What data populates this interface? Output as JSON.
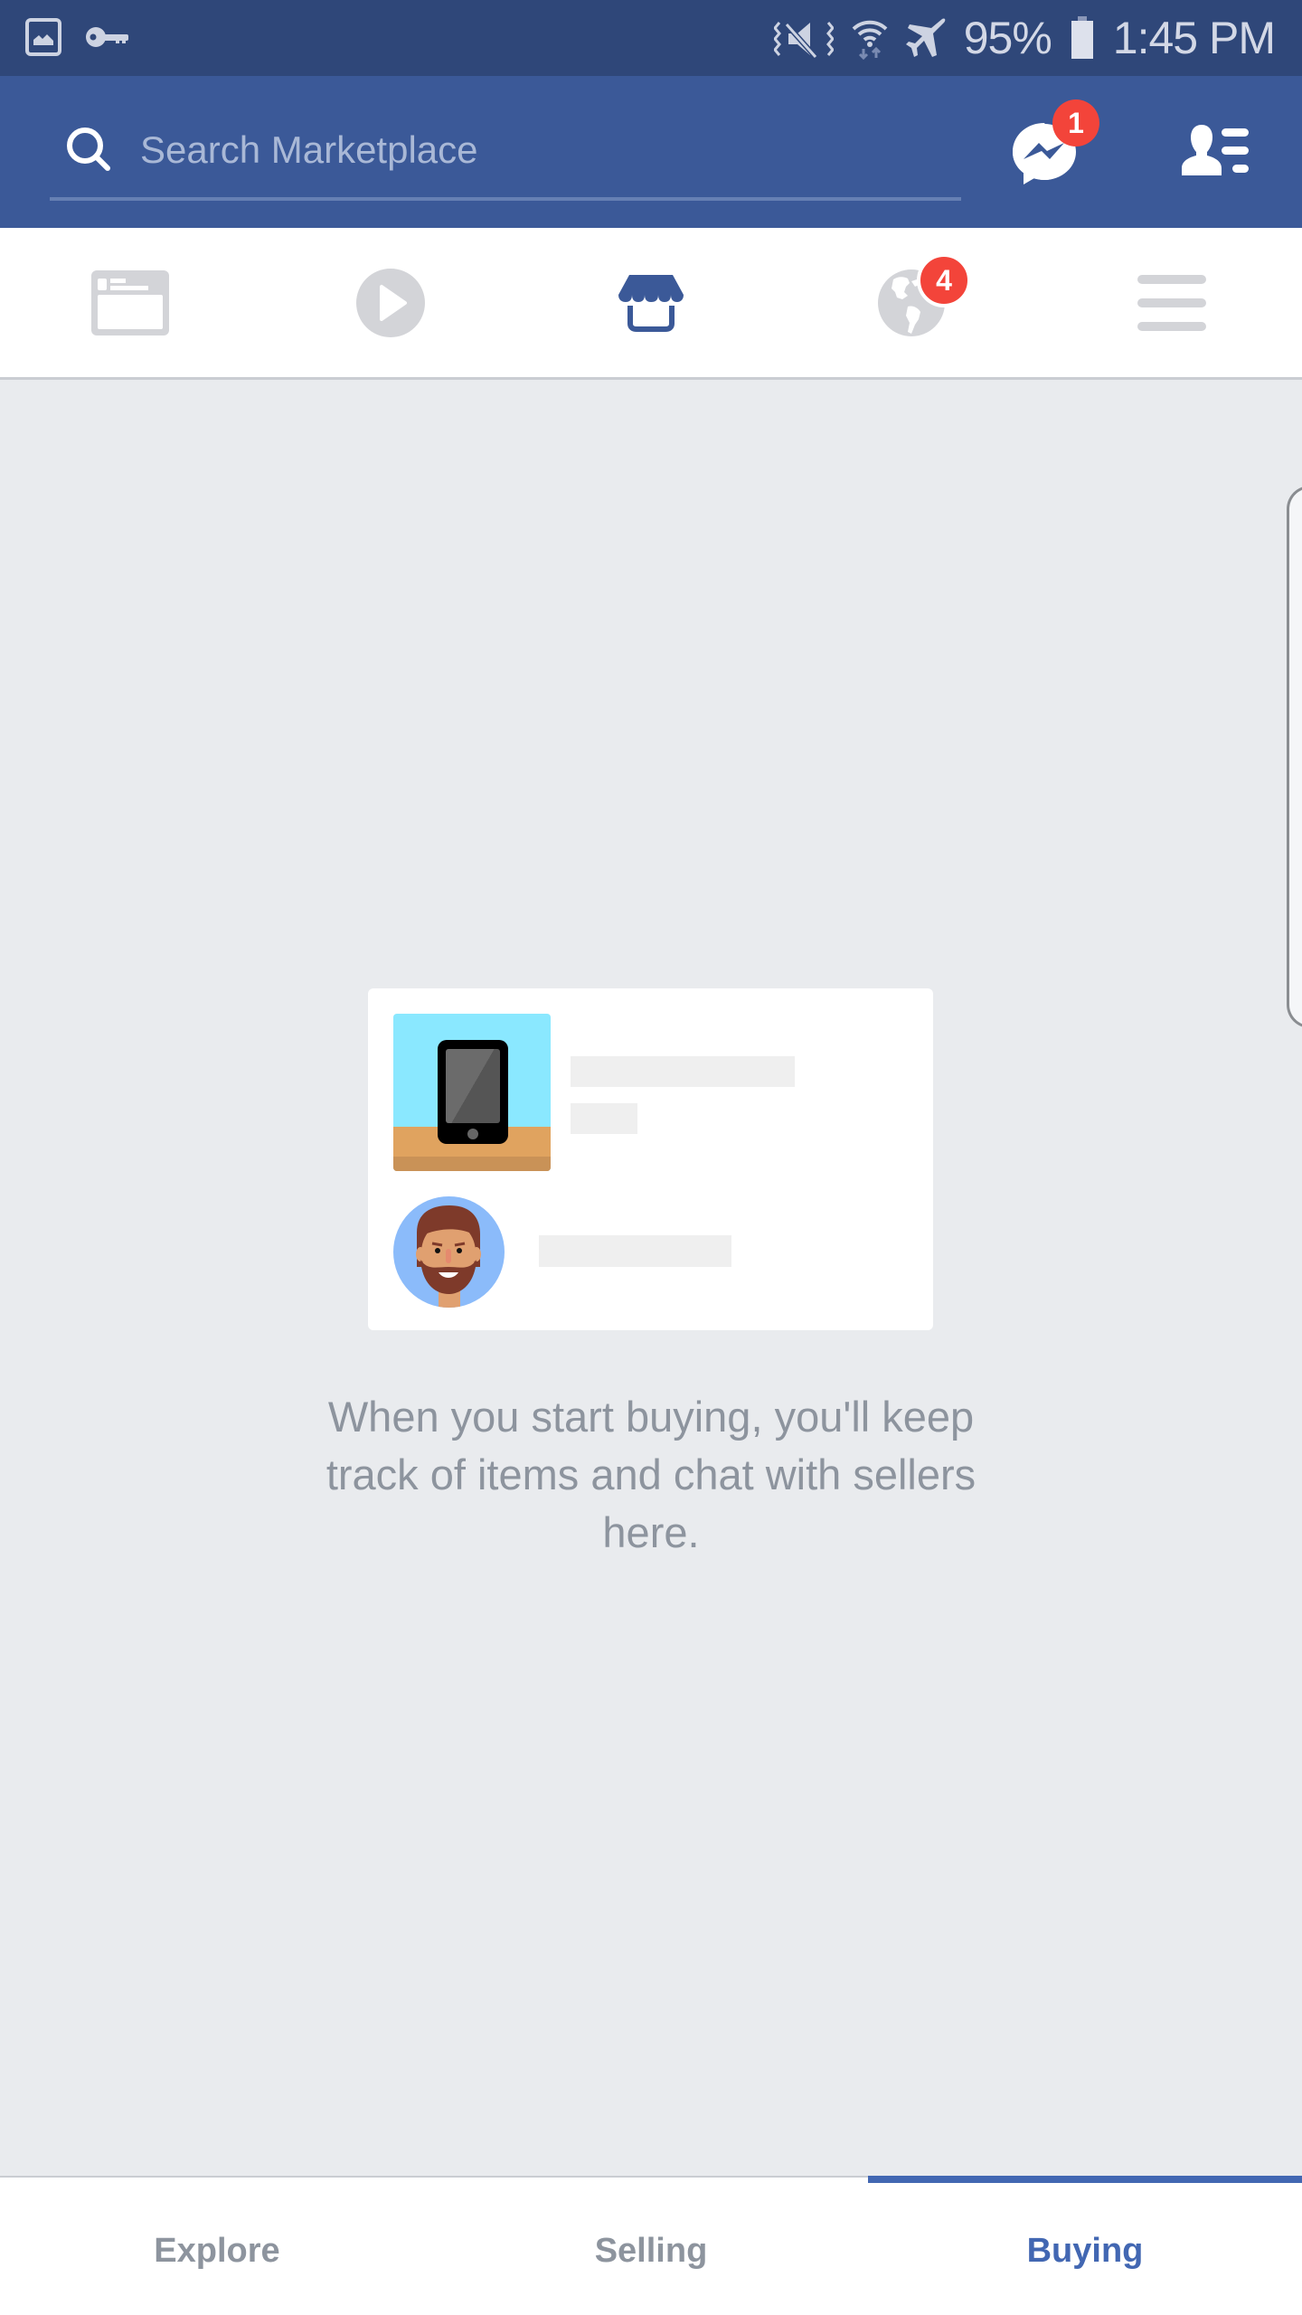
{
  "status_bar": {
    "left_icons": [
      "gallery-icon",
      "key-icon"
    ],
    "right_icons": [
      "vibrate-mute-icon",
      "wifi-data-icon",
      "airplane-mode-icon"
    ],
    "battery_percent": "95%",
    "battery_icon": "battery-icon",
    "time": "1:45 PM"
  },
  "header": {
    "search_placeholder": "Search Marketplace",
    "search_icon": "search-icon",
    "messenger_badge": "1",
    "messenger_icon": "messenger-icon",
    "friends_icon": "friend-requests-icon"
  },
  "nav": {
    "items": [
      {
        "name": "news-feed",
        "icon": "news-feed-icon",
        "active": false
      },
      {
        "name": "watch",
        "icon": "play-icon",
        "active": false
      },
      {
        "name": "marketplace",
        "icon": "storefront-icon",
        "active": true
      },
      {
        "name": "notifications",
        "icon": "globe-icon",
        "active": false,
        "badge": "4"
      },
      {
        "name": "menu",
        "icon": "hamburger-menu-icon",
        "active": false
      }
    ]
  },
  "empty_state": {
    "illustration": "listing-card-illustration",
    "message": "When you start buying, you'll keep track of items and chat with sellers here."
  },
  "tabs": [
    {
      "label": "Explore",
      "active": false
    },
    {
      "label": "Selling",
      "active": false
    },
    {
      "label": "Buying",
      "active": true
    }
  ],
  "colors": {
    "status_bar": "#2f4779",
    "header": "#3b5998",
    "accent": "#4267b2",
    "badge": "#f3443a",
    "background": "#e9ebee",
    "inactive_icon": "#d3d4d8",
    "muted_text": "#8d949e"
  }
}
